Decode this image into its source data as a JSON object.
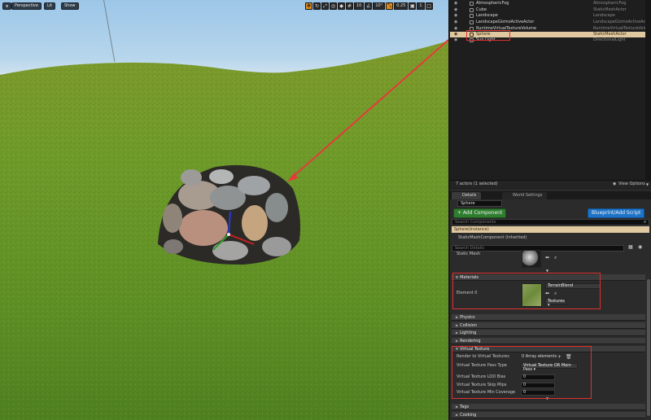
{
  "viewport": {
    "perspective_label": "Perspective",
    "lit_label": "Lit",
    "show_label": "Show",
    "grid_snap_value": "10",
    "rotation_snap_value": "10°",
    "scale_snap_value": "0.25",
    "camera_speed_value": "1"
  },
  "outliner": {
    "rows": [
      {
        "name": "AtmosphericFog",
        "type": "AtmosphericFog"
      },
      {
        "name": "Cube",
        "type": "StaticMeshActor"
      },
      {
        "name": "Landscape",
        "type": "Landscape"
      },
      {
        "name": "LandscapeGizmoActiveActor",
        "type": "LandscapeGizmoActiveActor"
      },
      {
        "name": "RuntimeVirtualTextureVolume",
        "type": "RuntimeVirtualTextureVolume"
      },
      {
        "name": "Sphere",
        "type": "StaticMeshActor"
      },
      {
        "name": "Sun Light",
        "type": "DirectionalLight"
      }
    ],
    "actor_count": "7 actors (1 selected)",
    "view_options": "View Options"
  },
  "tabs": {
    "details": "Details",
    "world_settings": "World Settings"
  },
  "details": {
    "actor_name": "Sphere",
    "add_component": "+ Add Component",
    "blueprint_script": "Blueprint/Add Script",
    "search_components_placeholder": "Search Components",
    "component_root": "Sphere(Instance)",
    "component_child": "StaticMeshComponent (Inherited)",
    "search_details_placeholder": "Search Details",
    "static_mesh_label": "Static Mesh",
    "materials_section": "Materials",
    "element0_label": "Element 0",
    "material_name": "TerrainBlend",
    "textures_dropdown": "Textures",
    "physics_section": "Physics",
    "collision_section": "Collision",
    "lighting_section": "Lighting",
    "rendering_section": "Rendering",
    "virtual_texture_section": "Virtual Texture",
    "render_to_vt_label": "Render to Virtual Textures",
    "render_to_vt_value": "0 Array elements",
    "vt_pass_type_label": "Virtual Texture Pass Type",
    "vt_pass_type_value": "Virtual Texture OR Main Pass",
    "vt_lod_bias_label": "Virtual Texture LOD Bias",
    "vt_lod_bias_value": "0",
    "vt_skip_mips_label": "Virtual Texture Skip Mips",
    "vt_skip_mips_value": "0",
    "vt_min_coverage_label": "Virtual Texture Min Coverage",
    "vt_min_coverage_value": "0",
    "tags_section": "Tags",
    "cooking_section": "Cooking"
  },
  "colors": {
    "selection": "#e0c9a0",
    "annotation_red": "#e03030",
    "add_component_green": "#2f7d2f",
    "blueprint_blue": "#1e73c8"
  }
}
